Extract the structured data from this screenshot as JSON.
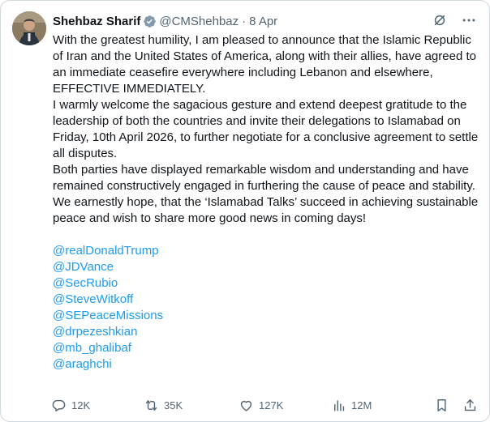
{
  "author": {
    "name": "Shehbaz Sharif",
    "handle": "@CMShehbaz",
    "separator": "·",
    "date": "8 Apr"
  },
  "tweet": {
    "lines": [
      "With the greatest humility, I am pleased to announce that the Islamic Republic of Iran and the United States of America, along with their allies, have agreed to an immediate ceasefire everywhere including Lebanon and elsewhere, EFFECTIVE IMMEDIATELY.",
      "I warmly welcome the sagacious gesture and extend deepest gratitude to the leadership of both the countries and invite their delegations to Islamabad on Friday, 10th April 2026, to further negotiate for a conclusive agreement to settle all disputes.",
      "Both parties have displayed remarkable wisdom and understanding and have remained constructively engaged in furthering the cause of peace and stability. We earnestly hope, that the ‘Islamabad Talks’ succeed in achieving sustainable peace and wish to share more good news in coming days!"
    ],
    "mentions": [
      "@realDonaldTrump",
      "@JDVance",
      "@SecRubio",
      "@SteveWitkoff",
      "@SEPeaceMissions",
      "@drpezeshkian",
      "@mb_ghalibaf",
      "@araghchi"
    ]
  },
  "actions": {
    "replies": "12K",
    "reposts": "35K",
    "likes": "127K",
    "views": "12M"
  },
  "icons": {
    "verified": "verified-badge-icon",
    "grok": "grok-icon",
    "more": "more-icon",
    "reply": "reply-icon",
    "repost": "repost-icon",
    "like": "heart-icon",
    "views": "views-icon",
    "bookmark": "bookmark-icon",
    "share": "share-icon"
  },
  "colors": {
    "link": "#1d9bf0",
    "muted": "#536471",
    "text": "#0f1419",
    "border": "#cfd9de"
  }
}
